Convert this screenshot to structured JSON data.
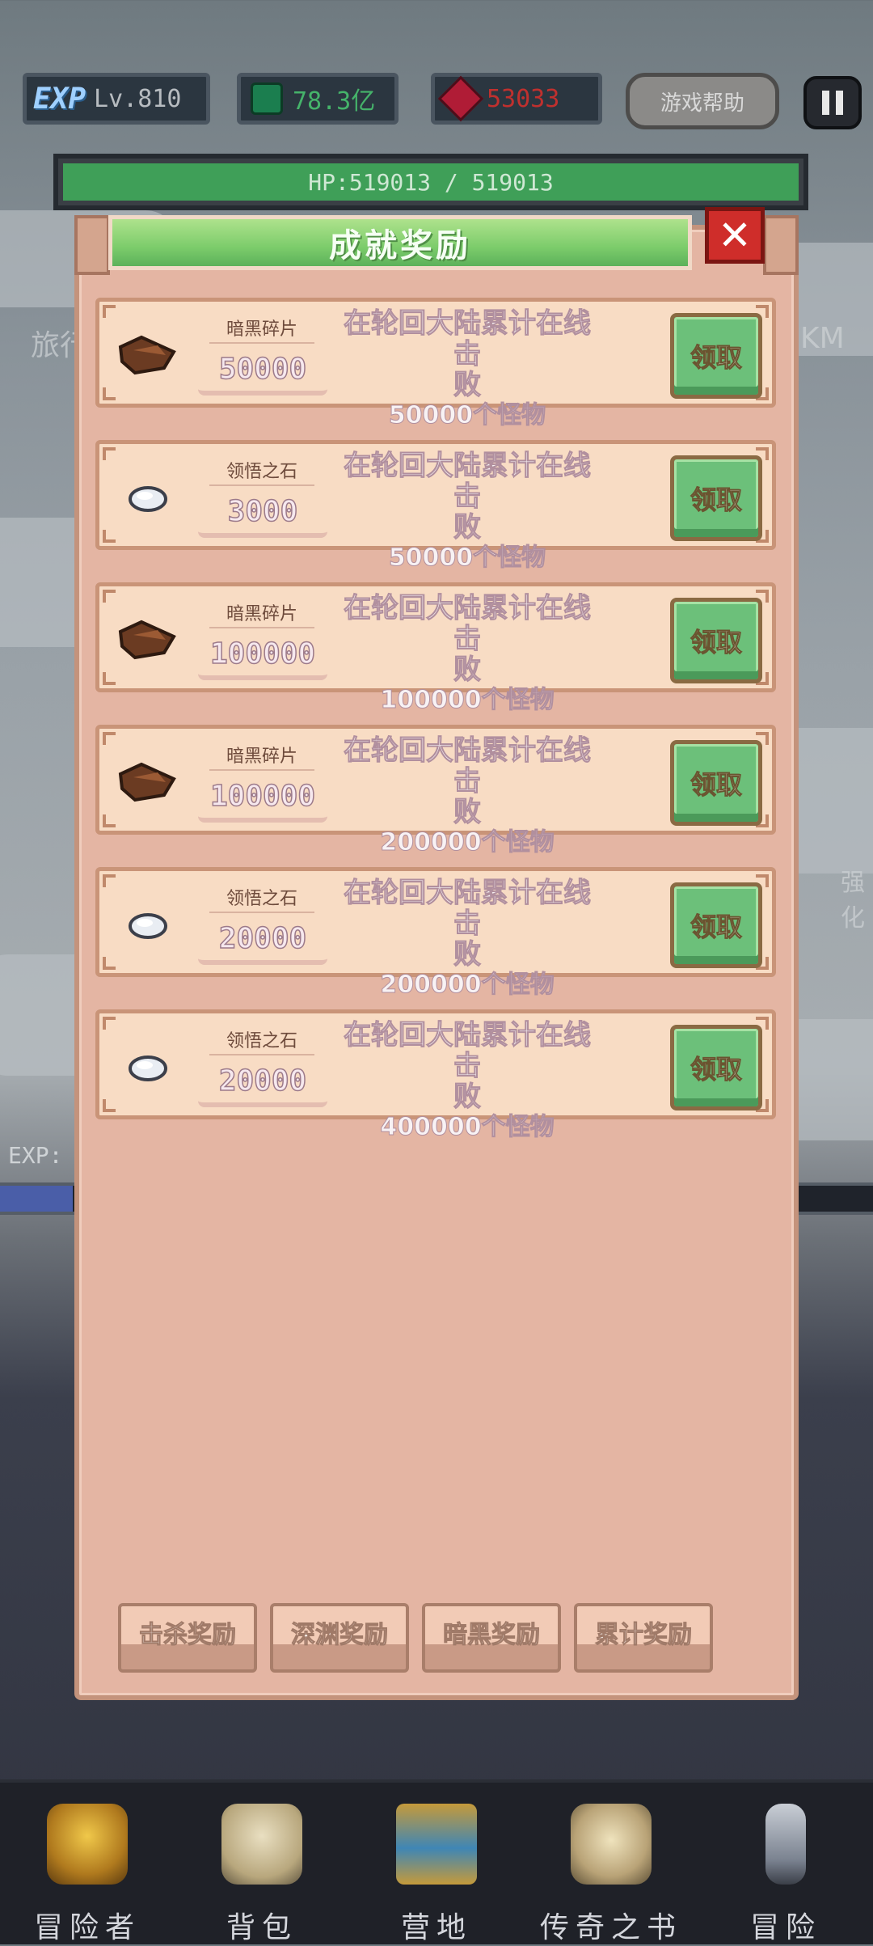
{
  "top": {
    "exp_logo": "EXP",
    "level": "Lv.810",
    "gems": "78.3亿",
    "rubies": "53033",
    "help_label": "游戏帮助"
  },
  "hp": {
    "text": "HP:519013 / 519013"
  },
  "background": {
    "left_text": "旅行",
    "right_text": "KM",
    "exp_text": "EXP:",
    "side_text": "强化"
  },
  "modal": {
    "title": "成就奖励",
    "rows": [
      {
        "item": "暗黑碎片",
        "qty": "50000",
        "line1": "在轮回大陆累计在线击",
        "line2": "败",
        "line3": "50000个怪物",
        "claim": "领取",
        "icon": "dark-shard-icon"
      },
      {
        "item": "领悟之石",
        "qty": "3000",
        "line1": "在轮回大陆累计在线击",
        "line2": "败",
        "line3": "50000个怪物",
        "claim": "领取",
        "icon": "insight-stone-icon"
      },
      {
        "item": "暗黑碎片",
        "qty": "100000",
        "line1": "在轮回大陆累计在线击",
        "line2": "败",
        "line3": "100000个怪物",
        "claim": "领取",
        "icon": "dark-shard-icon"
      },
      {
        "item": "暗黑碎片",
        "qty": "100000",
        "line1": "在轮回大陆累计在线击",
        "line2": "败",
        "line3": "200000个怪物",
        "claim": "领取",
        "icon": "dark-shard-icon"
      },
      {
        "item": "领悟之石",
        "qty": "20000",
        "line1": "在轮回大陆累计在线击",
        "line2": "败",
        "line3": "200000个怪物",
        "claim": "领取",
        "icon": "insight-stone-icon"
      },
      {
        "item": "领悟之石",
        "qty": "20000",
        "line1": "在轮回大陆累计在线击",
        "line2": "败",
        "line3": "400000个怪物",
        "claim": "领取",
        "icon": "insight-stone-icon"
      }
    ],
    "tabs": [
      "击杀奖励",
      "深渊奖励",
      "暗黑奖励",
      "累计奖励"
    ]
  },
  "nav": [
    "冒险者",
    "背包",
    "营地",
    "传奇之书",
    "冒险"
  ],
  "colors": {
    "accent_green": "#7ccc6b",
    "panel": "#e4b5a3",
    "close_red": "#cf2d2a"
  }
}
